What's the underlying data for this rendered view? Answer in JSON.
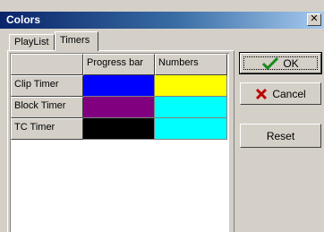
{
  "window": {
    "title": "Colors",
    "close_glyph": "✕"
  },
  "tabs": [
    {
      "label": "PlayList",
      "active": false
    },
    {
      "label": "Timers",
      "active": true
    }
  ],
  "grid": {
    "columns": [
      "Progress bar",
      "Numbers"
    ],
    "rows": [
      {
        "label": "Clip Timer",
        "progress_color": "#0000ff",
        "numbers_color": "#ffff00"
      },
      {
        "label": "Block Timer",
        "progress_color": "#800080",
        "numbers_color": "#00ffff"
      },
      {
        "label": "TC Timer",
        "progress_color": "#000000",
        "numbers_color": "#00ffff"
      }
    ]
  },
  "buttons": {
    "ok": {
      "label": "OK",
      "icon": "checkmark-icon"
    },
    "cancel": {
      "label": "Cancel",
      "icon": "x-icon"
    },
    "reset": {
      "label": "Reset"
    }
  },
  "colors": {
    "titlebar_start": "#0a246a",
    "titlebar_end": "#a6caf0",
    "face": "#d4d0c8"
  }
}
